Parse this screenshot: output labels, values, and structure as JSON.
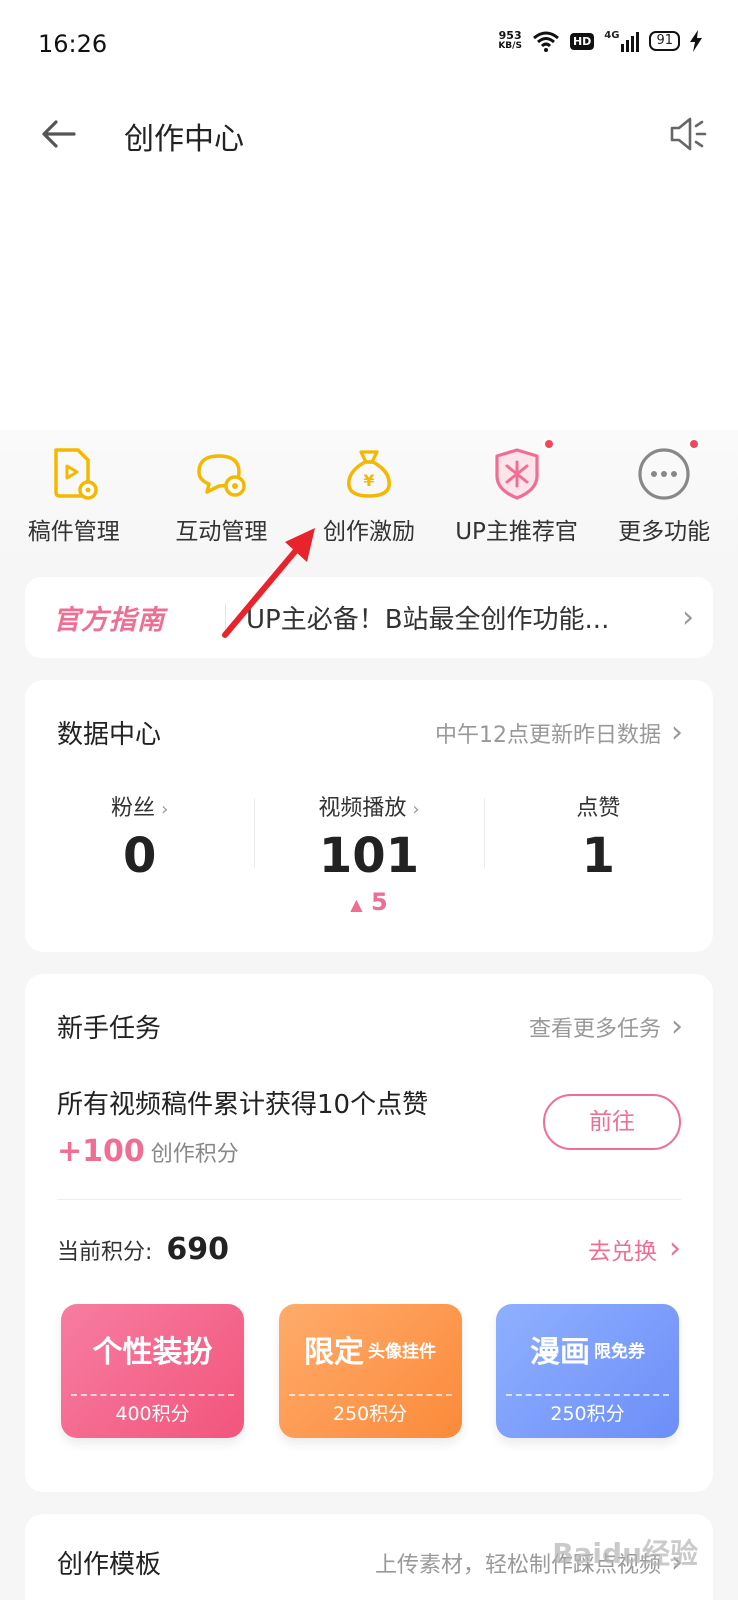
{
  "status_bar": {
    "time": "16:26",
    "speed_value": "953",
    "speed_unit": "KB/S",
    "hd": "HD",
    "network": "4G",
    "battery": "91"
  },
  "app_bar": {
    "title": "创作中心"
  },
  "quick_actions": [
    {
      "label": "稿件管理",
      "icon": "manuscript-icon",
      "badge": false
    },
    {
      "label": "互动管理",
      "icon": "chat-gear-icon",
      "badge": false
    },
    {
      "label": "创作激励",
      "icon": "money-bag-icon",
      "badge": false
    },
    {
      "label": "UP主推荐官",
      "icon": "award-badge-icon",
      "badge": true
    },
    {
      "label": "更多功能",
      "icon": "more-dots-icon",
      "badge": true
    }
  ],
  "guide": {
    "logo": "官方指南",
    "text": "UP主必备！B站最全创作功能..."
  },
  "data_center": {
    "title": "数据中心",
    "link": "中午12点更新昨日数据",
    "stats": [
      {
        "label": "粉丝",
        "value": "0",
        "delta": ""
      },
      {
        "label": "视频播放",
        "value": "101",
        "delta": "5"
      },
      {
        "label": "点赞",
        "value": "1",
        "delta": ""
      }
    ]
  },
  "tasks": {
    "title": "新手任务",
    "link": "查看更多任务",
    "task_name": "所有视频稿件累计获得10个点赞",
    "reward_amount": "+100",
    "reward_unit": "创作积分",
    "goto_label": "前往",
    "points_label": "当前积分:",
    "points_value": "690",
    "exchange_label": "去兑换",
    "coupons": [
      {
        "main": "个性装扮",
        "sub": "",
        "cost": "400积分"
      },
      {
        "main": "限定",
        "sub": "头像挂件",
        "cost": "250积分"
      },
      {
        "main": "漫画",
        "sub": "限免券",
        "cost": "250积分"
      }
    ]
  },
  "templates": {
    "title": "创作模板",
    "link": "上传素材，轻松制作踩点视频"
  },
  "watermark": "Baidu经验",
  "colors": {
    "accent": "#f06e94",
    "icon_yellow": "#f5b800",
    "annotation_red": "#e8232b"
  }
}
